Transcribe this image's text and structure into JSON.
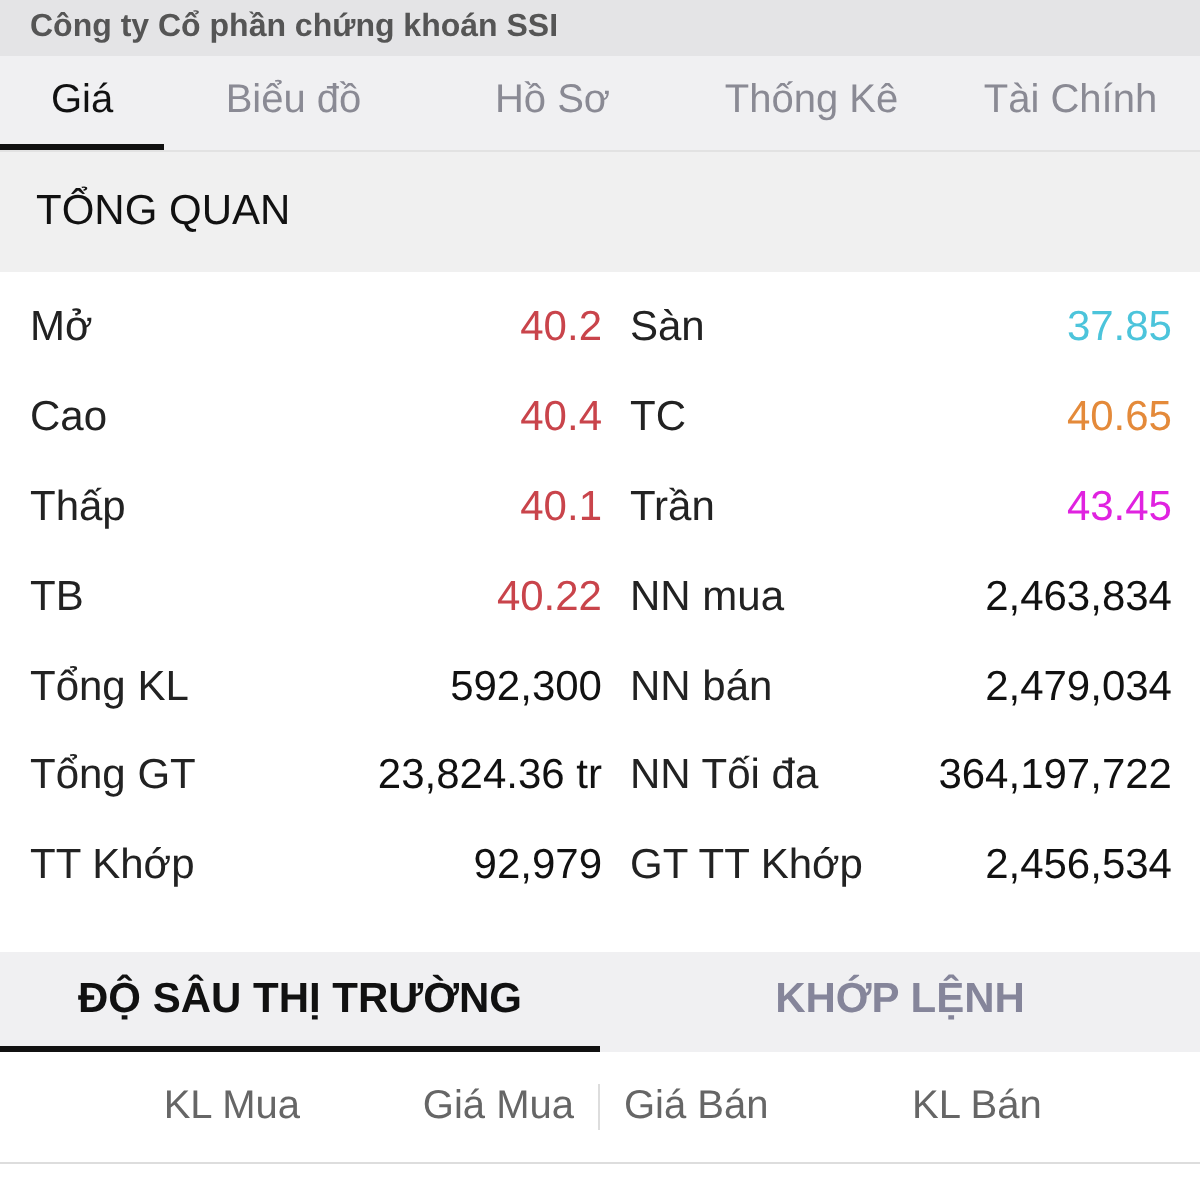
{
  "header": {
    "title": "Công ty Cổ phần chứng khoán SSI"
  },
  "tabs": [
    {
      "label": "Giá",
      "selected": true
    },
    {
      "label": "Biểu đồ",
      "selected": false
    },
    {
      "label": "Hồ Sơ",
      "selected": false
    },
    {
      "label": "Thống Kê",
      "selected": false
    },
    {
      "label": "Tài Chính",
      "selected": false
    }
  ],
  "overview": {
    "title": "TỔNG QUAN",
    "left": [
      {
        "label": "Mở",
        "value": "40.2",
        "color": "#c9444b"
      },
      {
        "label": "Cao",
        "value": "40.4",
        "color": "#c9444b"
      },
      {
        "label": "Thấp",
        "value": "40.1",
        "color": "#c9444b"
      },
      {
        "label": "TB",
        "value": "40.22",
        "color": "#c9444b"
      },
      {
        "label": "Tổng KL",
        "value": "592,300",
        "color": "#111111"
      },
      {
        "label": "Tổng GT",
        "value": "23,824.36 tr",
        "color": "#111111"
      },
      {
        "label": "TT Khớp",
        "value": "92,979",
        "color": "#111111"
      }
    ],
    "right": [
      {
        "label": "Sàn",
        "value": "37.85",
        "color": "#4cc4db"
      },
      {
        "label": "TC",
        "value": "40.65",
        "color": "#e48a3a"
      },
      {
        "label": "Trần",
        "value": "43.45",
        "color": "#e022e0"
      },
      {
        "label": "NN mua",
        "value": "2,463,834",
        "color": "#111111"
      },
      {
        "label": "NN bán",
        "value": "2,479,034",
        "color": "#111111"
      },
      {
        "label": "NN Tối đa",
        "value": "364,197,722",
        "color": "#111111"
      },
      {
        "label": "GT TT Khớp",
        "value": "2,456,534",
        "color": "#111111"
      }
    ]
  },
  "market_tabs": [
    {
      "label": "ĐỘ SÂU THỊ TRƯỜNG",
      "selected": true
    },
    {
      "label": "KHỚP LỆNH",
      "selected": false
    }
  ],
  "depth_table": {
    "columns": [
      "KL Mua",
      "Giá Mua",
      "Giá Bán",
      "KL Bán"
    ]
  }
}
